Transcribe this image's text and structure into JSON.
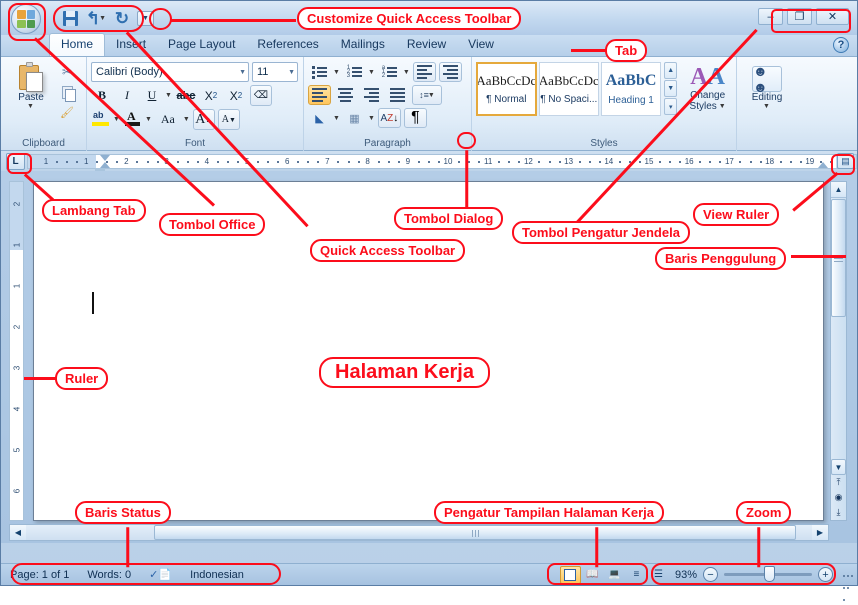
{
  "window": {
    "controls": {
      "minimize": "–",
      "maximize": "❐",
      "close": "✕"
    },
    "help_icon": "?"
  },
  "quick_access": {
    "save_label": "Save",
    "undo_label": "↶",
    "redo_label": "↻",
    "customize_label": "▾"
  },
  "tabs": [
    {
      "label": "Home",
      "active": true
    },
    {
      "label": "Insert",
      "active": false
    },
    {
      "label": "Page Layout",
      "active": false
    },
    {
      "label": "References",
      "active": false
    },
    {
      "label": "Mailings",
      "active": false
    },
    {
      "label": "Review",
      "active": false
    },
    {
      "label": "View",
      "active": false
    }
  ],
  "ribbon": {
    "clipboard": {
      "label": "Clipboard",
      "paste": "Paste",
      "cut": "Cut",
      "copy": "Copy",
      "format_painter": "Format Painter"
    },
    "font": {
      "label": "Font",
      "font_name": "Calibri (Body)",
      "font_size": "11",
      "bold": "B",
      "italic": "I",
      "underline": "U",
      "strikethrough": "abc",
      "subscript": "X",
      "subscript_sub": "2",
      "superscript": "X",
      "superscript_sup": "2",
      "clear_formatting": "Aa",
      "highlight": "ab",
      "font_color": "A",
      "change_case": "Aa",
      "grow_font": "A",
      "shrink_font": "A"
    },
    "paragraph": {
      "label": "Paragraph",
      "bullets": "Bullets",
      "numbering": "Numbering",
      "multilevel": "Multilevel List",
      "decrease_indent": "Decrease Indent",
      "increase_indent": "Increase Indent",
      "align_left": "Align Left",
      "center": "Center",
      "align_right": "Align Right",
      "justify": "Justify",
      "line_spacing": "Line Spacing",
      "shading": "Shading",
      "borders": "Borders",
      "sort": "Sort",
      "show_marks": "¶"
    },
    "styles": {
      "label": "Styles",
      "items": [
        {
          "preview": "AaBbCcDc",
          "name": "¶ Normal",
          "selected": true
        },
        {
          "preview": "AaBbCcDc",
          "name": "¶ No Spaci...",
          "selected": false
        },
        {
          "preview": "AaBbC",
          "name": "Heading 1",
          "selected": false
        }
      ],
      "change_styles_line1": "Change",
      "change_styles_line2": "Styles"
    },
    "editing": {
      "label": "Editing",
      "find": "Find"
    }
  },
  "ruler": {
    "tab_marker": "L",
    "h_ticks": [
      "1",
      "1",
      "2",
      "3",
      "4",
      "5",
      "6",
      "7",
      "8",
      "9",
      "10",
      "11",
      "12",
      "13",
      "14",
      "15",
      "16",
      "17",
      "18",
      "19"
    ],
    "v_ticks": [
      "2",
      "1",
      "1",
      "2",
      "3",
      "4",
      "5",
      "6"
    ],
    "view_ruler_icon": "▤"
  },
  "status": {
    "page": "Page: 1 of 1",
    "words": "Words: 0",
    "proofing_icon": "proofing-icon",
    "language": "Indonesian",
    "zoom_percent": "93%",
    "zoom_out": "−",
    "zoom_in": "+",
    "views": [
      {
        "name": "print-layout",
        "selected": true
      },
      {
        "name": "full-screen-reading",
        "selected": false
      },
      {
        "name": "web-layout",
        "selected": false
      },
      {
        "name": "outline",
        "selected": false
      },
      {
        "name": "draft",
        "selected": false
      }
    ]
  },
  "annotations": [
    {
      "id": "customize-qat",
      "text": "Customize Quick Access Toolbar"
    },
    {
      "id": "tab",
      "text": "Tab"
    },
    {
      "id": "lambang-tab",
      "text": "Lambang Tab"
    },
    {
      "id": "tombol-office",
      "text": "Tombol Office"
    },
    {
      "id": "quick-access-toolbar",
      "text": "Quick Access Toolbar"
    },
    {
      "id": "tombol-dialog",
      "text": "Tombol Dialog"
    },
    {
      "id": "tombol-pengatur-jendela",
      "text": "Tombol Pengatur Jendela"
    },
    {
      "id": "view-ruler",
      "text": "View Ruler"
    },
    {
      "id": "baris-penggulung",
      "text": "Baris Penggulung"
    },
    {
      "id": "ruler",
      "text": "Ruler"
    },
    {
      "id": "halaman-kerja",
      "text": "Halaman Kerja"
    },
    {
      "id": "baris-status",
      "text": "Baris Status"
    },
    {
      "id": "pengatur-tampilan",
      "text": "Pengatur Tampilan Halaman Kerja"
    },
    {
      "id": "zoom",
      "text": "Zoom"
    }
  ],
  "colors": {
    "annotation": "#fc0d1b",
    "accent": "#ffc65c",
    "chrome": "#b9d0e8"
  }
}
